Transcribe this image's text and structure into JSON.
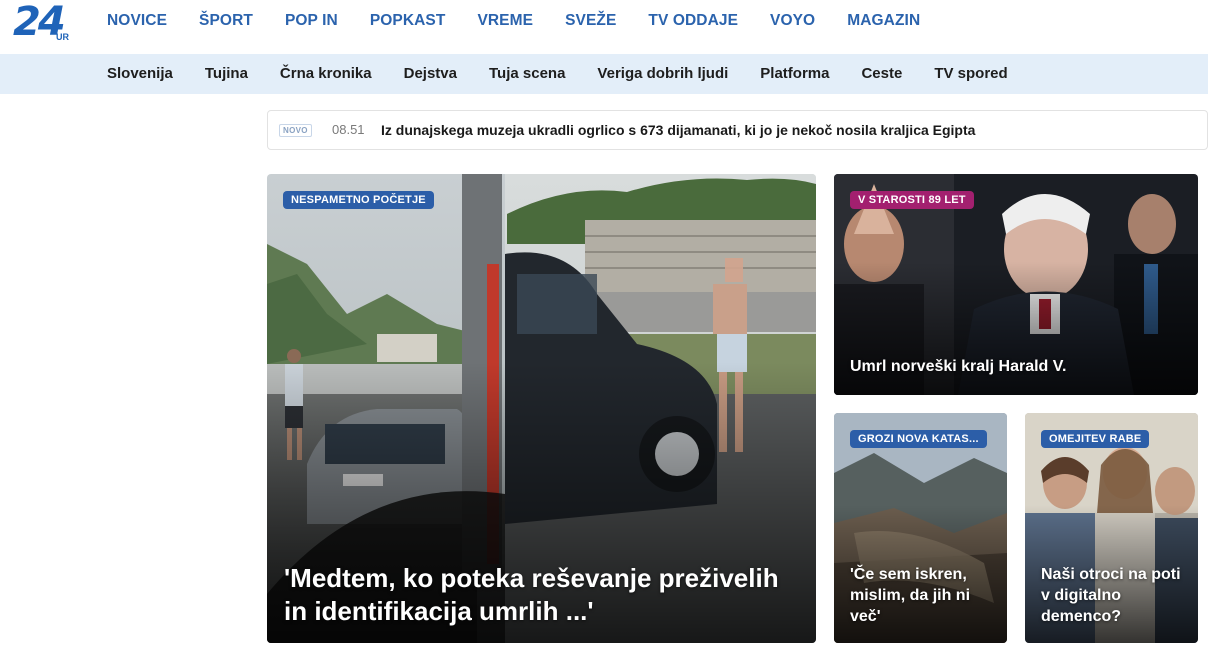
{
  "logo": {
    "number": "24",
    "sub": "UR"
  },
  "top_nav": [
    "NOVICE",
    "ŠPORT",
    "POP IN",
    "POPKAST",
    "VREME",
    "SVEŽE",
    "TV ODDAJE",
    "VOYO",
    "MAGAZIN"
  ],
  "sub_nav": [
    "Slovenija",
    "Tujina",
    "Črna kronika",
    "Dejstva",
    "Tuja scena",
    "Veriga dobrih ljudi",
    "Platforma",
    "Ceste",
    "TV spored"
  ],
  "ticker": {
    "tag": "NOVO",
    "time": "08.51",
    "headline": "Iz dunajskega muzeja ukradli ogrlico s 673 dijamanati, ki jo je nekoč nosila kraljica Egipta"
  },
  "cards": {
    "main": {
      "badge": "NESPAMETNO POČETJE",
      "title": "'Medtem, ko poteka reševanje preživelih in identifikacija umrlih ...'"
    },
    "king": {
      "badge": "V STAROSTI 89 LET",
      "title": "Umrl norveški kralj Harald V."
    },
    "flood": {
      "badge": "GROZI NOVA KATAS...",
      "title": "'Če sem iskren, mislim, da jih ni več'"
    },
    "kids": {
      "badge": "OMEJITEV RABE",
      "title": "Naši otroci na poti v digitalno demenco?"
    }
  },
  "colors": {
    "brand_blue": "#2b63ad",
    "subnav_bg": "#e3eef9",
    "badge_blue": "#2c5ea8",
    "badge_magenta": "#a3206f"
  }
}
